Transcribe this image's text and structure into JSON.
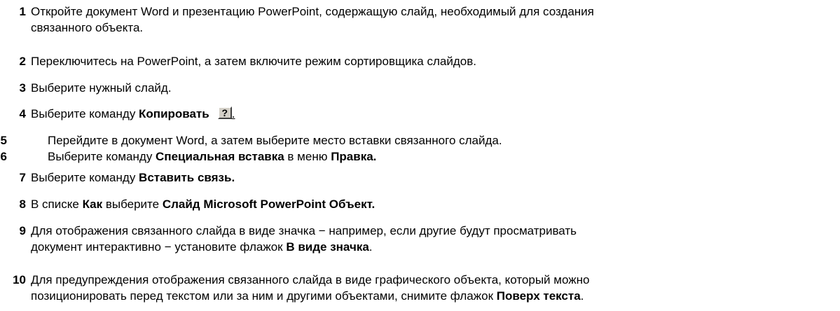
{
  "steps": [
    {
      "num": "1",
      "lines": [
        [
          {
            "t": "Откройте документ Word и презентацию PowerPoint, содержащую слайд, необходимый для создания"
          }
        ],
        [
          {
            "t": "связанного объекта."
          }
        ]
      ]
    },
    {
      "num": "2",
      "lines": [
        [
          {
            "t": "Переключитесь на PowerPoint, а затем включите режим сортировщика слайдов."
          }
        ]
      ]
    },
    {
      "num": "3",
      "lines": [
        [
          {
            "t": "Выберите нужный слайд."
          }
        ]
      ]
    },
    {
      "num": "4",
      "lines": [
        [
          {
            "t": "Выберите команду "
          },
          {
            "t": "Копировать",
            "b": true
          }
        ]
      ],
      "help_icon": "?",
      "trail": "."
    },
    {
      "num": "5",
      "lines": [
        [
          {
            "t": "Перейдите в документ Word, а затем выберите место вставки связанного слайда."
          }
        ]
      ]
    },
    {
      "num": "6",
      "lines": [
        [
          {
            "t": "Выберите команду "
          },
          {
            "t": "Специальная вставка",
            "b": true
          },
          {
            "t": " в меню "
          },
          {
            "t": "Правка.",
            "b": true
          }
        ]
      ]
    },
    {
      "num": "7",
      "lines": [
        [
          {
            "t": "Выберите команду "
          },
          {
            "t": "Вставить связь.",
            "b": true
          }
        ]
      ]
    },
    {
      "num": "8",
      "lines": [
        [
          {
            "t": "В списке "
          },
          {
            "t": "Как",
            "b": true
          },
          {
            "t": " выберите "
          },
          {
            "t": "Слайд Microsoft PowerPoint Объект.",
            "b": true
          }
        ]
      ]
    },
    {
      "num": "9",
      "lines": [
        [
          {
            "t": "Для отображения связанного слайда в виде значка − например, если другие будут просматривать"
          }
        ],
        [
          {
            "t": "документ интерактивно − установите флажок "
          },
          {
            "t": "В виде значка",
            "b": true
          },
          {
            "t": "."
          }
        ]
      ]
    },
    {
      "num": "10",
      "lines": [
        [
          {
            "t": "Для предупреждения отображения связанного слайда в виде графического объекта, который можно"
          }
        ],
        [
          {
            "t": "позиционировать перед текстом или за ним и другими объектами, снимите флажок "
          },
          {
            "t": "Поверх текста",
            "b": true
          },
          {
            "t": "."
          }
        ]
      ]
    }
  ]
}
